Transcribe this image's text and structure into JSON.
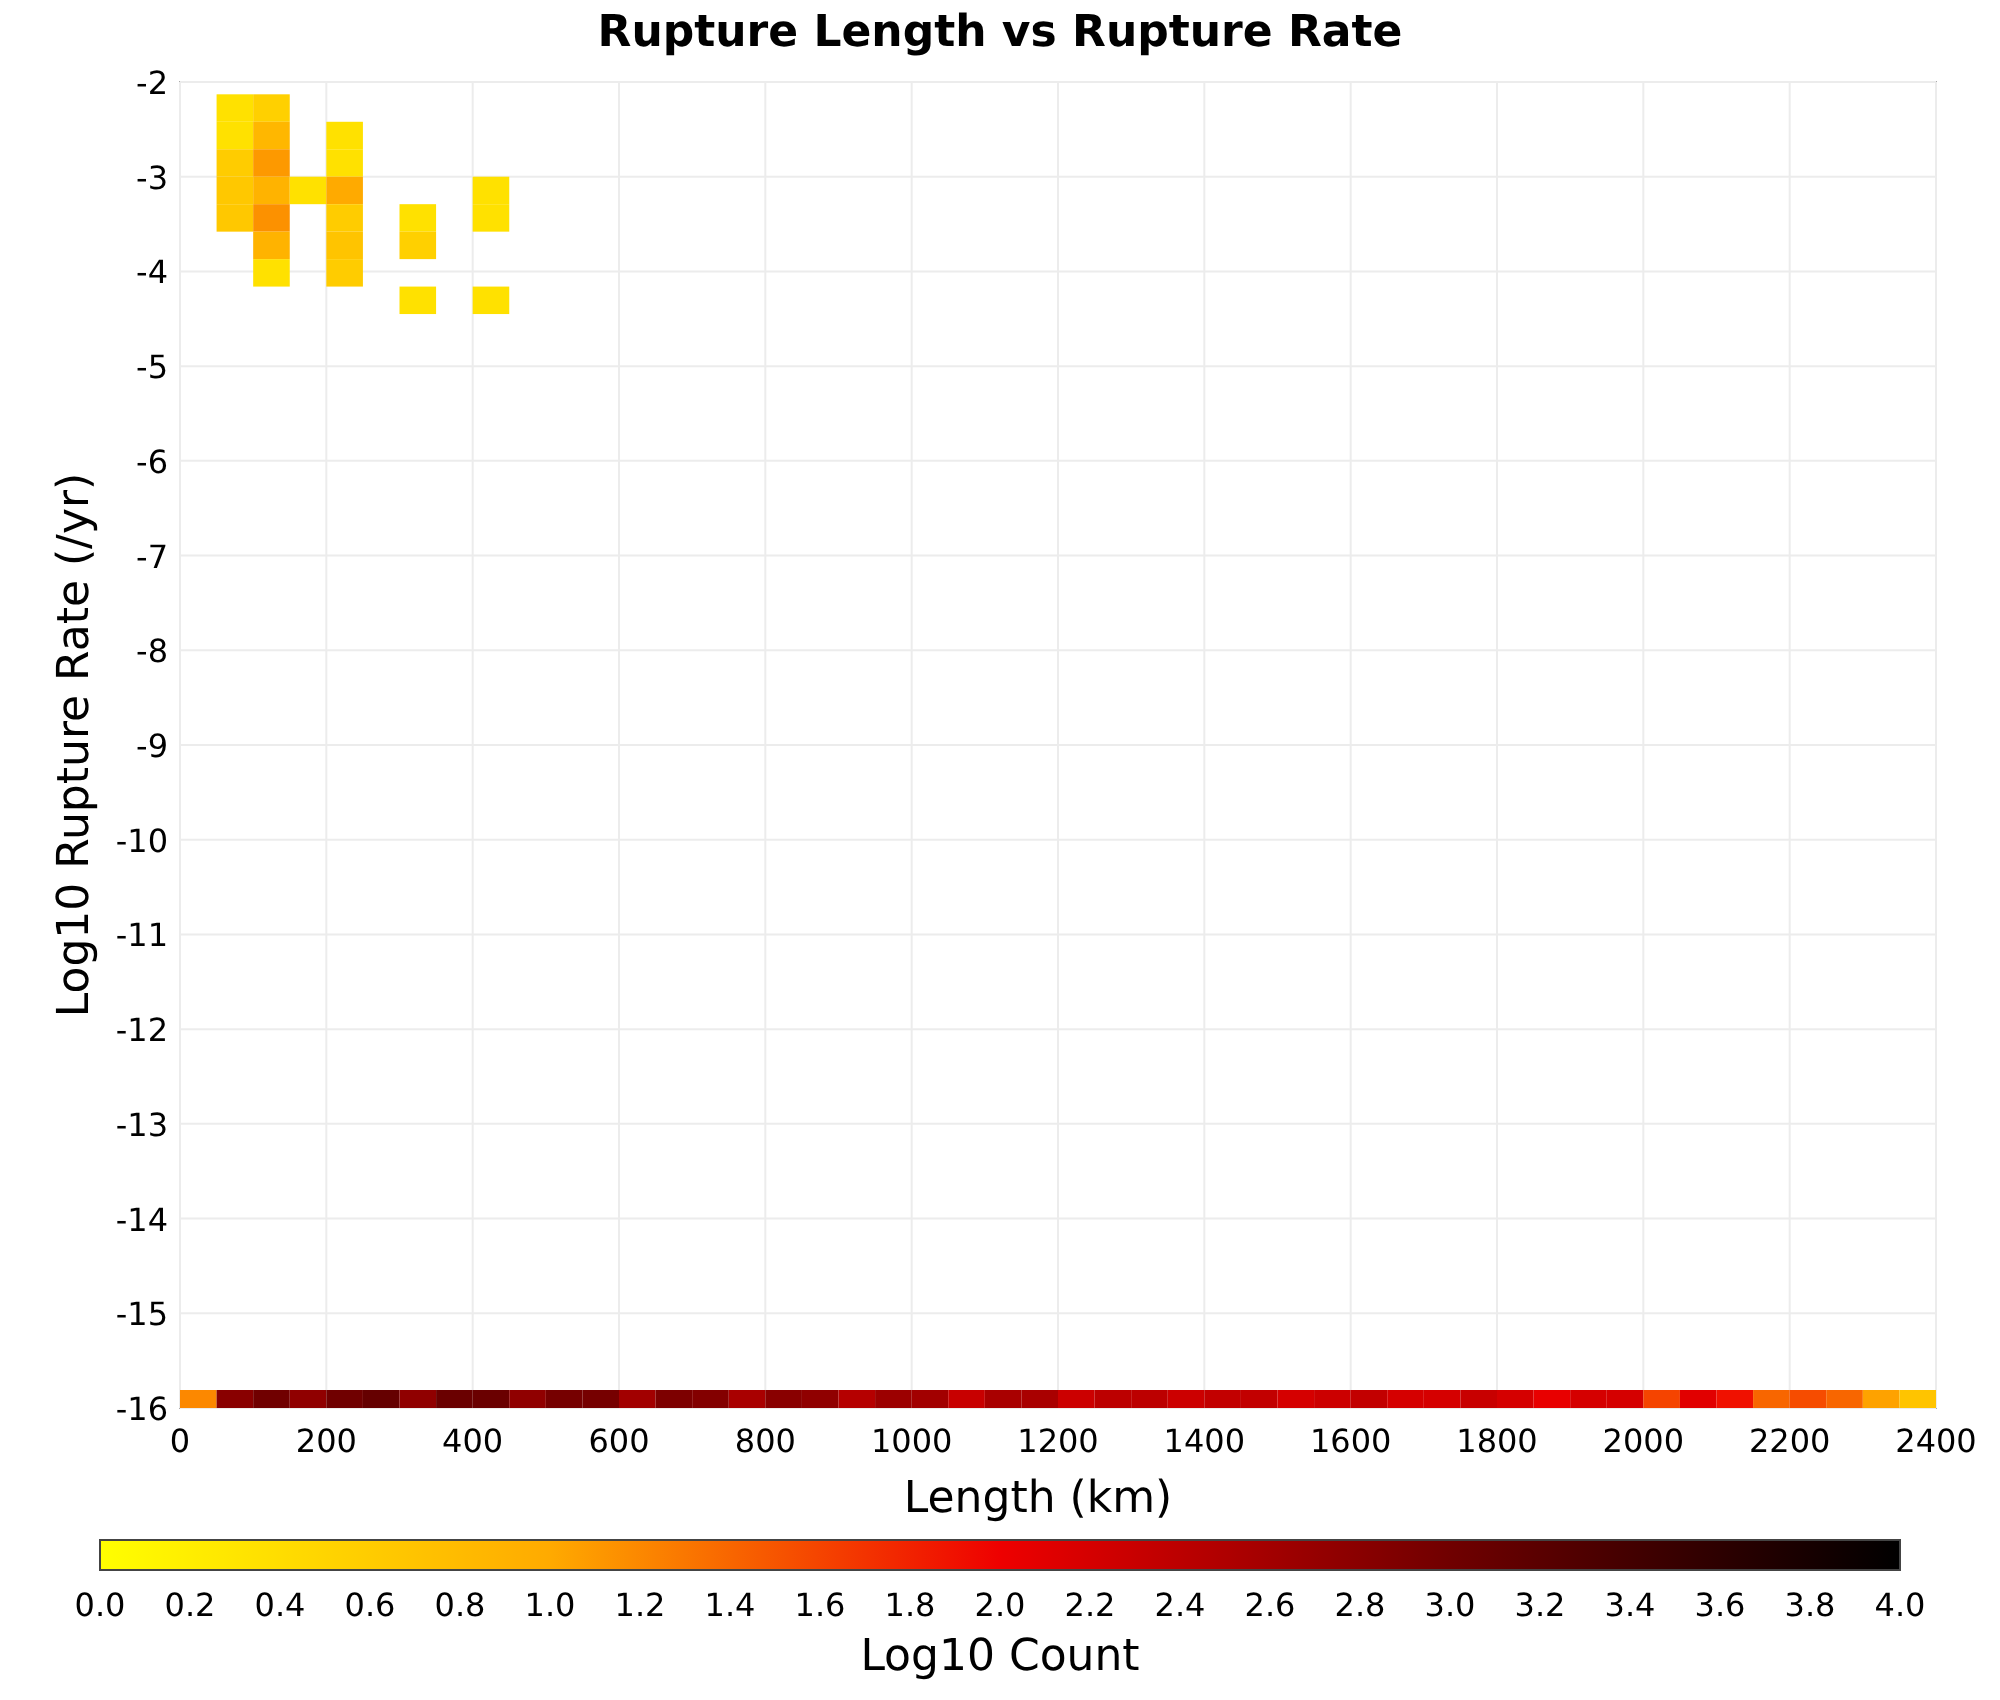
{
  "chart_data": {
    "type": "heatmap",
    "title": "Rupture Length vs Rupture Rate",
    "xlabel": "Length (km)",
    "ylabel": "Log10 Rupture Rate (/yr)",
    "xlim": [
      0,
      2400
    ],
    "ylim": [
      -16,
      -2
    ],
    "grid": true,
    "xticks": [
      {
        "value": 0,
        "label": "0"
      },
      {
        "value": 200,
        "label": "200"
      },
      {
        "value": 400,
        "label": "400"
      },
      {
        "value": 600,
        "label": "600"
      },
      {
        "value": 800,
        "label": "800"
      },
      {
        "value": 1000,
        "label": "1000"
      },
      {
        "value": 1200,
        "label": "1200"
      },
      {
        "value": 1400,
        "label": "1400"
      },
      {
        "value": 1600,
        "label": "1600"
      },
      {
        "value": 1800,
        "label": "1800"
      },
      {
        "value": 2000,
        "label": "2000"
      },
      {
        "value": 2200,
        "label": "2200"
      },
      {
        "value": 2400,
        "label": "2400"
      }
    ],
    "yticks": [
      {
        "value": -2,
        "label": "-2"
      },
      {
        "value": -3,
        "label": "-3"
      },
      {
        "value": -4,
        "label": "-4"
      },
      {
        "value": -5,
        "label": "-5"
      },
      {
        "value": -6,
        "label": "-6"
      },
      {
        "value": -7,
        "label": "-7"
      },
      {
        "value": -8,
        "label": "-8"
      },
      {
        "value": -9,
        "label": "-9"
      },
      {
        "value": -10,
        "label": "-10"
      },
      {
        "value": -11,
        "label": "-11"
      },
      {
        "value": -12,
        "label": "-12"
      },
      {
        "value": -13,
        "label": "-13"
      },
      {
        "value": -14,
        "label": "-14"
      },
      {
        "value": -15,
        "label": "-15"
      },
      {
        "value": -16,
        "label": "-16"
      }
    ]
  },
  "color_scale": {
    "label": "Log10 Count",
    "ticks": [
      "0.0",
      "0.2",
      "0.4",
      "0.6",
      "0.8",
      "1.0",
      "1.2",
      "1.4",
      "1.6",
      "1.8",
      "2.0",
      "2.2",
      "2.4",
      "2.6",
      "2.8",
      "3.0",
      "3.2",
      "3.4",
      "3.6",
      "3.8",
      "4.0"
    ]
  }
}
